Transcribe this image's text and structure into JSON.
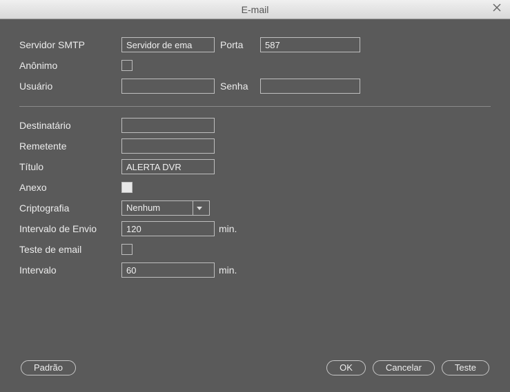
{
  "window": {
    "title": "E-mail"
  },
  "labels": {
    "smtp_server": "Servidor SMTP",
    "port": "Porta",
    "anonymous": "Anônimo",
    "user": "Usuário",
    "password": "Senha",
    "recipient": "Destinatário",
    "sender": "Remetente",
    "titleField": "Título",
    "attachment": "Anexo",
    "encryption": "Criptografia",
    "send_interval": "Intervalo de Envio",
    "email_test": "Teste de email",
    "interval": "Intervalo",
    "min_suffix": "min."
  },
  "fields": {
    "smtp_server": "Servidor de ema",
    "port": "587",
    "anonymous": false,
    "user": "",
    "password": "",
    "recipient": "",
    "sender": "",
    "title": "ALERTA DVR",
    "attachment": true,
    "encryption": "Nenhum",
    "send_interval": "120",
    "email_test": false,
    "interval": "60"
  },
  "buttons": {
    "default": "Padrão",
    "ok": "OK",
    "cancel": "Cancelar",
    "test": "Teste"
  }
}
